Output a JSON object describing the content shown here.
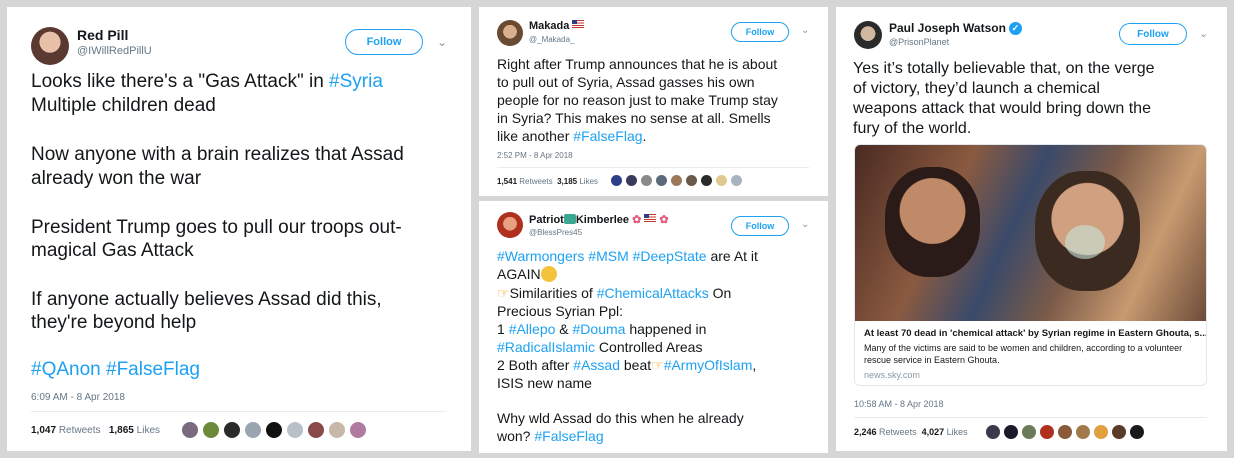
{
  "colors": {
    "link": "#1da1f2",
    "meta": "#657786",
    "text": "#14171a",
    "background": "#d6d6d6"
  },
  "tweet1": {
    "name": "Red Pill",
    "handle": "@IWillRedPillU",
    "follow": "Follow",
    "lines": [
      {
        "text": "Looks like there's a \"Gas Attack\" in ",
        "tag": "#Syria"
      },
      {
        "text": "Multiple children dead"
      },
      {
        "text": "Now anyone with a brain realizes that Assad"
      },
      {
        "text": "already won the war"
      },
      {
        "text": "President Trump goes to pull our troops out-"
      },
      {
        "text": "magical Gas Attack"
      },
      {
        "text": "If anyone actually believes Assad did this,"
      },
      {
        "text": "they're beyond help"
      }
    ],
    "tags_line": "#QAnon #FalseFlag",
    "timestamp": "6:09 AM - 8 Apr 2018",
    "retweets": "1,047",
    "retweets_label": "Retweets",
    "likes": "1,865",
    "likes_label": "Likes"
  },
  "tweet2": {
    "name": "Makada",
    "flag_icon": "us-flag-icon",
    "handle": "@_Makada_",
    "follow": "Follow",
    "lines": [
      "Right after Trump announces that he is about",
      "to pull out of Syria, Assad gasses his own",
      "people for no reason just to make Trump stay",
      "in Syria? This makes no sense at all. Smells"
    ],
    "last_line_text": "like another ",
    "last_line_tag": "#FalseFlag",
    "last_line_end": ".",
    "timestamp": "2:52 PM - 8 Apr 2018",
    "retweets": "1,541",
    "retweets_label": "Retweets",
    "likes": "3,185",
    "likes_label": "Likes"
  },
  "tweet3": {
    "name_a": "Patriot",
    "name_b": "Kimberlee",
    "handle": "@BlessPres45",
    "follow": "Follow",
    "l1_tags": "#Warmongers #MSM #DeepState",
    "l1_text": " are At it",
    "l2_text": "AGAIN",
    "l3_text": "Similarities of ",
    "l3_tag": "#ChemicalAttacks",
    "l3_end": " On",
    "l4_text": "Precious Syrian Ppl:",
    "l5_a": "1 ",
    "l5_tag1": "#Allepo",
    "l5_b": " & ",
    "l5_tag2": "#Douma",
    "l5_c": " happened in",
    "l6_tag": "#RadicalIslamic",
    "l6_text": " Controlled Areas",
    "l7_a": "2 Both after ",
    "l7_tag1": "#Assad",
    "l7_b": " beat",
    "l7_tag2": "#ArmyOfIslam",
    "l7_c": ",",
    "l8_text": "ISIS new name",
    "l9_text": "Why wld Assad do this when he already",
    "l10_text": "won? ",
    "l10_tag": "#FalseFlag"
  },
  "tweet4": {
    "name": "Paul Joseph Watson",
    "handle": "@PrisonPlanet",
    "follow": "Follow",
    "lines": [
      "Yes it’s totally believable that, on the verge",
      "of victory, they’d launch a chemical",
      "weapons attack that would bring down the",
      "fury of the world."
    ],
    "card_title": "At least 70 dead in 'chemical attack' by Syrian regime in Eastern Ghouta, s...",
    "card_desc_1": "Many of the victims are said to be women and children, according to a volunteer",
    "card_desc_2": "rescue service in Eastern Ghouta.",
    "card_domain": "news.sky.com",
    "timestamp": "10:58 AM - 8 Apr 2018",
    "retweets": "2,246",
    "retweets_label": "Retweets",
    "likes": "4,027",
    "likes_label": "Likes"
  }
}
